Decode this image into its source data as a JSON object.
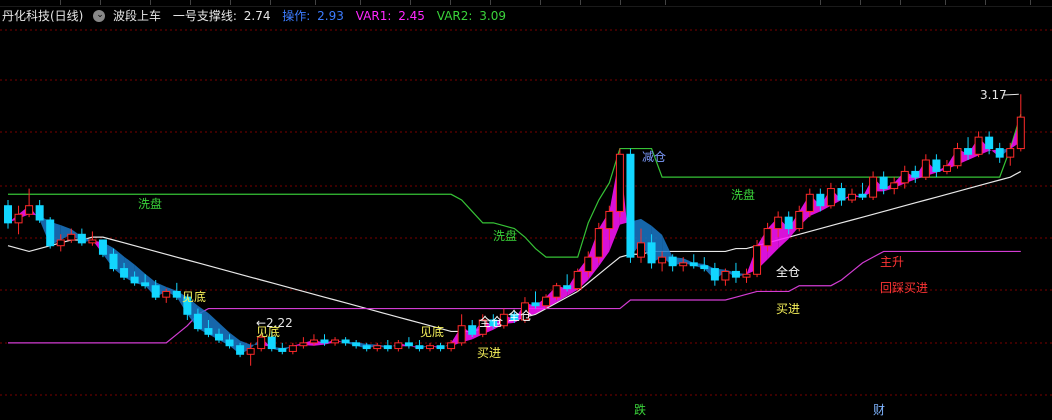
{
  "header": {
    "stock_name": "丹化科技(日线)",
    "indicator_name": "波段上车",
    "support_label": "一号支撑线:",
    "support_value": "2.74",
    "op_label": "操作:",
    "op_value": "2.93",
    "var1_label": "VAR1:",
    "var1_value": "2.45",
    "var2_label": "VAR2:",
    "var2_value": "3.09"
  },
  "colors": {
    "up": "#ff2a2a",
    "down": "#12d6ff",
    "ribbon": "#ff14ff",
    "ribbon_dark": "#1a78c8",
    "support_line": "#d23cd2",
    "white_line": "#e8e8e8",
    "wash_line": "#36c236",
    "label_green": "#3ad33a",
    "label_yellow": "#f7f25a",
    "label_red": "#ff3434",
    "label_blue": "#7e9cff",
    "grid": "#7a0000"
  },
  "chart_data": {
    "type": "candlestick",
    "price_high_label": "3.17",
    "price_low_label": "2.22",
    "ohlc": [
      [
        2.78,
        2.8,
        2.7,
        2.72
      ],
      [
        2.72,
        2.78,
        2.68,
        2.75
      ],
      [
        2.75,
        2.84,
        2.74,
        2.78
      ],
      [
        2.78,
        2.8,
        2.72,
        2.73
      ],
      [
        2.73,
        2.74,
        2.63,
        2.64
      ],
      [
        2.64,
        2.68,
        2.62,
        2.66
      ],
      [
        2.66,
        2.7,
        2.65,
        2.68
      ],
      [
        2.68,
        2.7,
        2.64,
        2.65
      ],
      [
        2.65,
        2.69,
        2.64,
        2.66
      ],
      [
        2.66,
        2.66,
        2.6,
        2.61
      ],
      [
        2.61,
        2.63,
        2.55,
        2.56
      ],
      [
        2.56,
        2.58,
        2.52,
        2.53
      ],
      [
        2.53,
        2.55,
        2.5,
        2.51
      ],
      [
        2.51,
        2.54,
        2.49,
        2.5
      ],
      [
        2.5,
        2.52,
        2.45,
        2.46
      ],
      [
        2.46,
        2.49,
        2.44,
        2.48
      ],
      [
        2.48,
        2.51,
        2.45,
        2.46
      ],
      [
        2.46,
        2.47,
        2.38,
        2.4
      ],
      [
        2.4,
        2.42,
        2.34,
        2.35
      ],
      [
        2.35,
        2.38,
        2.32,
        2.33
      ],
      [
        2.33,
        2.35,
        2.3,
        2.31
      ],
      [
        2.31,
        2.33,
        2.28,
        2.29
      ],
      [
        2.29,
        2.3,
        2.25,
        2.26
      ],
      [
        2.26,
        2.3,
        2.22,
        2.28
      ],
      [
        2.28,
        2.33,
        2.27,
        2.32
      ],
      [
        2.32,
        2.34,
        2.27,
        2.28
      ],
      [
        2.28,
        2.3,
        2.26,
        2.27
      ],
      [
        2.27,
        2.3,
        2.26,
        2.29
      ],
      [
        2.29,
        2.32,
        2.28,
        2.3
      ],
      [
        2.3,
        2.33,
        2.29,
        2.31
      ],
      [
        2.31,
        2.33,
        2.29,
        2.3
      ],
      [
        2.3,
        2.32,
        2.29,
        2.31
      ],
      [
        2.31,
        2.32,
        2.29,
        2.3
      ],
      [
        2.3,
        2.31,
        2.28,
        2.29
      ],
      [
        2.29,
        2.3,
        2.27,
        2.28
      ],
      [
        2.28,
        2.3,
        2.27,
        2.29
      ],
      [
        2.29,
        2.31,
        2.27,
        2.28
      ],
      [
        2.28,
        2.31,
        2.27,
        2.3
      ],
      [
        2.3,
        2.32,
        2.28,
        2.29
      ],
      [
        2.29,
        2.31,
        2.27,
        2.28
      ],
      [
        2.28,
        2.3,
        2.27,
        2.29
      ],
      [
        2.29,
        2.3,
        2.27,
        2.28
      ],
      [
        2.28,
        2.31,
        2.27,
        2.3
      ],
      [
        2.3,
        2.4,
        2.29,
        2.36
      ],
      [
        2.36,
        2.38,
        2.32,
        2.33
      ],
      [
        2.33,
        2.4,
        2.32,
        2.38
      ],
      [
        2.38,
        2.4,
        2.35,
        2.36
      ],
      [
        2.36,
        2.42,
        2.35,
        2.4
      ],
      [
        2.4,
        2.41,
        2.37,
        2.38
      ],
      [
        2.38,
        2.46,
        2.37,
        2.44
      ],
      [
        2.44,
        2.48,
        2.42,
        2.43
      ],
      [
        2.43,
        2.47,
        2.42,
        2.46
      ],
      [
        2.46,
        2.51,
        2.45,
        2.5
      ],
      [
        2.5,
        2.54,
        2.48,
        2.49
      ],
      [
        2.49,
        2.56,
        2.48,
        2.55
      ],
      [
        2.55,
        2.62,
        2.53,
        2.6
      ],
      [
        2.6,
        2.72,
        2.58,
        2.7
      ],
      [
        2.7,
        2.78,
        2.66,
        2.76
      ],
      [
        2.76,
        2.98,
        2.74,
        2.96
      ],
      [
        2.96,
        2.98,
        2.58,
        2.6
      ],
      [
        2.6,
        2.7,
        2.58,
        2.65
      ],
      [
        2.65,
        2.68,
        2.56,
        2.58
      ],
      [
        2.58,
        2.62,
        2.55,
        2.6
      ],
      [
        2.6,
        2.61,
        2.55,
        2.57
      ],
      [
        2.57,
        2.6,
        2.55,
        2.58
      ],
      [
        2.58,
        2.61,
        2.56,
        2.57
      ],
      [
        2.57,
        2.6,
        2.55,
        2.56
      ],
      [
        2.56,
        2.58,
        2.5,
        2.52
      ],
      [
        2.52,
        2.56,
        2.5,
        2.55
      ],
      [
        2.55,
        2.58,
        2.51,
        2.53
      ],
      [
        2.53,
        2.56,
        2.51,
        2.54
      ],
      [
        2.54,
        2.66,
        2.53,
        2.64
      ],
      [
        2.64,
        2.72,
        2.62,
        2.7
      ],
      [
        2.7,
        2.76,
        2.67,
        2.74
      ],
      [
        2.74,
        2.76,
        2.68,
        2.7
      ],
      [
        2.7,
        2.78,
        2.69,
        2.76
      ],
      [
        2.76,
        2.84,
        2.74,
        2.82
      ],
      [
        2.82,
        2.84,
        2.76,
        2.78
      ],
      [
        2.78,
        2.86,
        2.77,
        2.84
      ],
      [
        2.84,
        2.86,
        2.78,
        2.8
      ],
      [
        2.8,
        2.84,
        2.79,
        2.82
      ],
      [
        2.82,
        2.86,
        2.8,
        2.81
      ],
      [
        2.81,
        2.9,
        2.8,
        2.88
      ],
      [
        2.88,
        2.9,
        2.82,
        2.84
      ],
      [
        2.84,
        2.88,
        2.82,
        2.86
      ],
      [
        2.86,
        2.92,
        2.84,
        2.9
      ],
      [
        2.9,
        2.92,
        2.86,
        2.88
      ],
      [
        2.88,
        2.96,
        2.87,
        2.94
      ],
      [
        2.94,
        2.96,
        2.88,
        2.9
      ],
      [
        2.9,
        2.94,
        2.89,
        2.92
      ],
      [
        2.92,
        3.0,
        2.91,
        2.98
      ],
      [
        2.98,
        3.02,
        2.94,
        2.96
      ],
      [
        2.96,
        3.04,
        2.95,
        3.02
      ],
      [
        3.02,
        3.04,
        2.96,
        2.98
      ],
      [
        2.98,
        3.0,
        2.93,
        2.95
      ],
      [
        2.95,
        3.0,
        2.92,
        2.98
      ],
      [
        2.98,
        3.17,
        2.97,
        3.09
      ]
    ],
    "white_line": [
      2.64,
      2.63,
      2.62,
      2.63,
      2.64,
      2.65,
      2.66,
      2.66,
      2.67,
      2.67,
      2.66,
      2.65,
      2.64,
      2.63,
      2.62,
      2.61,
      2.6,
      2.59,
      2.58,
      2.57,
      2.56,
      2.55,
      2.54,
      2.53,
      2.52,
      2.51,
      2.5,
      2.49,
      2.48,
      2.47,
      2.46,
      2.45,
      2.44,
      2.43,
      2.42,
      2.41,
      2.4,
      2.39,
      2.38,
      2.37,
      2.36,
      2.35,
      2.34,
      2.34,
      2.34,
      2.35,
      2.36,
      2.37,
      2.38,
      2.39,
      2.4,
      2.42,
      2.44,
      2.46,
      2.48,
      2.51,
      2.54,
      2.57,
      2.6,
      2.61,
      2.61,
      2.62,
      2.62,
      2.62,
      2.62,
      2.62,
      2.62,
      2.62,
      2.62,
      2.63,
      2.63,
      2.64,
      2.65,
      2.66,
      2.67,
      2.68,
      2.69,
      2.7,
      2.71,
      2.72,
      2.73,
      2.74,
      2.75,
      2.76,
      2.77,
      2.78,
      2.79,
      2.8,
      2.81,
      2.82,
      2.83,
      2.84,
      2.85,
      2.86,
      2.87,
      2.88,
      2.9
    ],
    "support_line": [
      2.3,
      2.3,
      2.3,
      2.3,
      2.3,
      2.3,
      2.3,
      2.3,
      2.3,
      2.3,
      2.3,
      2.3,
      2.3,
      2.3,
      2.3,
      2.3,
      2.33,
      2.36,
      2.4,
      2.42,
      2.42,
      2.42,
      2.42,
      2.42,
      2.42,
      2.42,
      2.42,
      2.42,
      2.42,
      2.42,
      2.42,
      2.42,
      2.42,
      2.42,
      2.42,
      2.42,
      2.42,
      2.42,
      2.42,
      2.42,
      2.42,
      2.42,
      2.42,
      2.42,
      2.42,
      2.42,
      2.42,
      2.42,
      2.42,
      2.42,
      2.42,
      2.42,
      2.42,
      2.42,
      2.42,
      2.42,
      2.42,
      2.42,
      2.42,
      2.45,
      2.45,
      2.45,
      2.45,
      2.45,
      2.45,
      2.45,
      2.45,
      2.45,
      2.45,
      2.46,
      2.47,
      2.48,
      2.48,
      2.48,
      2.48,
      2.5,
      2.5,
      2.5,
      2.5,
      2.52,
      2.55,
      2.58,
      2.6,
      2.62,
      2.62,
      2.62,
      2.62,
      2.62,
      2.62,
      2.62,
      2.62,
      2.62,
      2.62,
      2.62,
      2.62,
      2.62,
      2.62
    ],
    "wash_line": [
      2.82,
      2.82,
      2.82,
      2.82,
      2.82,
      2.82,
      2.82,
      2.82,
      2.82,
      2.82,
      2.82,
      2.82,
      2.82,
      2.82,
      2.82,
      2.82,
      2.82,
      2.82,
      2.82,
      2.82,
      2.82,
      2.82,
      2.82,
      2.82,
      2.82,
      2.82,
      2.82,
      2.82,
      2.82,
      2.82,
      2.82,
      2.82,
      2.82,
      2.82,
      2.82,
      2.82,
      2.82,
      2.82,
      2.82,
      2.82,
      2.82,
      2.82,
      2.82,
      2.8,
      2.76,
      2.72,
      2.72,
      2.71,
      2.7,
      2.67,
      2.63,
      2.6,
      2.6,
      2.6,
      2.6,
      2.72,
      2.8,
      2.86,
      2.98,
      2.98,
      2.98,
      2.98,
      2.88,
      2.88,
      2.88,
      2.88,
      2.88,
      2.88,
      2.88,
      2.88,
      2.88,
      2.88,
      2.88,
      2.88,
      2.88,
      2.88,
      2.88,
      2.88,
      2.88,
      2.88,
      2.88,
      2.88,
      2.88,
      2.88,
      2.88,
      2.88,
      2.88,
      2.88,
      2.88,
      2.88,
      2.88,
      2.88,
      2.88,
      2.88,
      2.88,
      2.98,
      3.1
    ],
    "labels": {
      "wash1": "洗盘",
      "wash2": "洗盘",
      "wash3": "洗盘",
      "jiandi1": "见底",
      "jiandi2": "见底",
      "jiandi3": "见底",
      "quancang1": "全仓",
      "quancang2": "全仓",
      "quancang3": "全仓",
      "mairjin1": "买进",
      "mairjin2": "买进",
      "jiancang": "减仓",
      "zhusheng": "主升",
      "huicai": "回踩买进",
      "die": "跌",
      "cai": "财"
    }
  }
}
